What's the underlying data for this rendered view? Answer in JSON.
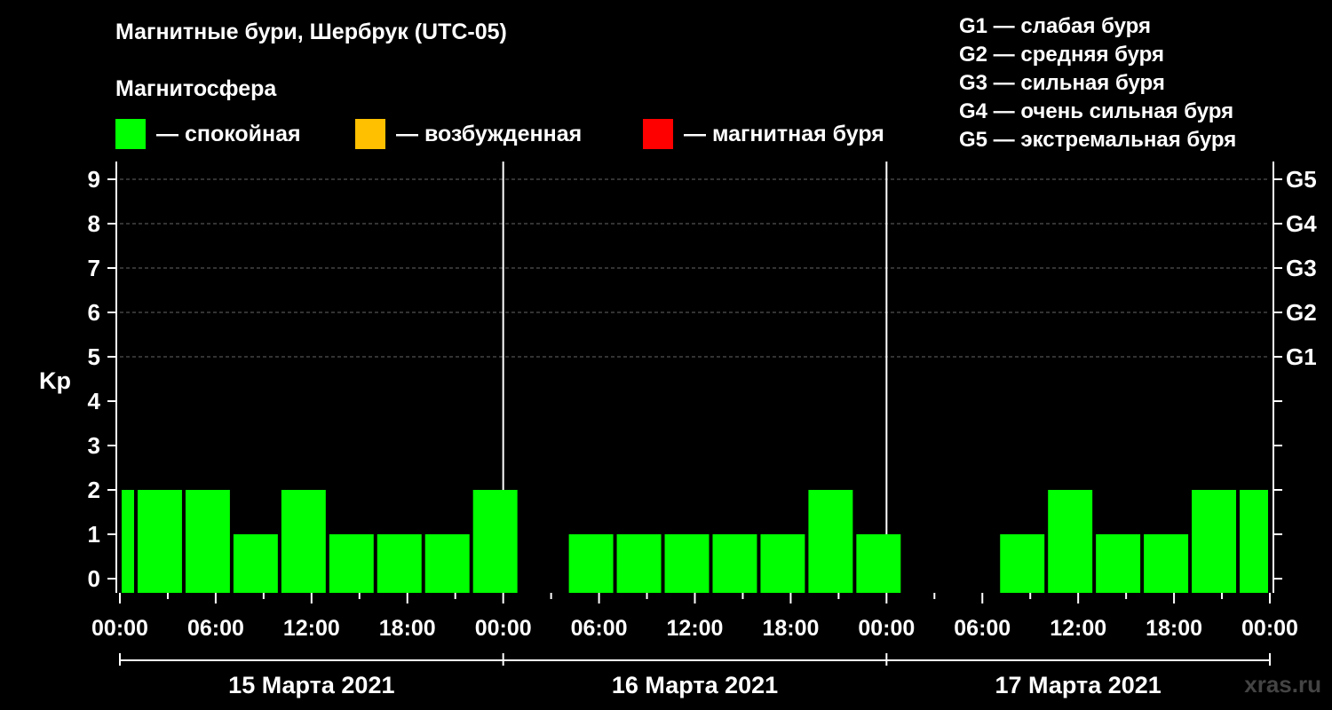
{
  "header": {
    "title": "Магнитные бури, Шербрук (UTC-05)",
    "subtitle": "Магнитосфера"
  },
  "legend": [
    {
      "label": "— спокойная",
      "color": "#00ff00"
    },
    {
      "label": "— возбужденная",
      "color": "#ffc000"
    },
    {
      "label": "— магнитная буря",
      "color": "#ff0000"
    }
  ],
  "storm_levels": [
    "G1 — слабая буря",
    "G2 — средняя буря",
    "G3 — сильная буря",
    "G4 — очень сильная буря",
    "G5 — экстремальная буря"
  ],
  "watermark": "xras.ru",
  "chart_data": {
    "type": "bar",
    "ylabel": "Kp",
    "ylim": [
      0,
      9
    ],
    "yticks": [
      "0",
      "1",
      "2",
      "3",
      "4",
      "5",
      "6",
      "7",
      "8",
      "9"
    ],
    "right_ticks": [
      {
        "kp": 5,
        "label": "G1"
      },
      {
        "kp": 6,
        "label": "G2"
      },
      {
        "kp": 7,
        "label": "G3"
      },
      {
        "kp": 8,
        "label": "G4"
      },
      {
        "kp": 9,
        "label": "G5"
      }
    ],
    "xticks": [
      "00:00",
      "06:00",
      "12:00",
      "18:00",
      "00:00",
      "06:00",
      "12:00",
      "18:00",
      "00:00",
      "06:00",
      "12:00",
      "18:00",
      "00:00"
    ],
    "days": [
      "15 Марта 2021",
      "16 Марта 2021",
      "17 Марта 2021"
    ],
    "grid": "dashed horizontal at Kp 5-9",
    "bars": [
      {
        "start_h": 0,
        "end_h": 1,
        "kp": 2
      },
      {
        "start_h": 1,
        "end_h": 4,
        "kp": 2
      },
      {
        "start_h": 4,
        "end_h": 7,
        "kp": 2
      },
      {
        "start_h": 7,
        "end_h": 10,
        "kp": 1
      },
      {
        "start_h": 10,
        "end_h": 13,
        "kp": 2
      },
      {
        "start_h": 13,
        "end_h": 16,
        "kp": 1
      },
      {
        "start_h": 16,
        "end_h": 19,
        "kp": 1
      },
      {
        "start_h": 19,
        "end_h": 22,
        "kp": 1
      },
      {
        "start_h": 22,
        "end_h": 25,
        "kp": 2
      },
      {
        "start_h": 25,
        "end_h": 28,
        "kp": 0
      },
      {
        "start_h": 28,
        "end_h": 31,
        "kp": 1
      },
      {
        "start_h": 31,
        "end_h": 34,
        "kp": 1
      },
      {
        "start_h": 34,
        "end_h": 37,
        "kp": 1
      },
      {
        "start_h": 37,
        "end_h": 40,
        "kp": 1
      },
      {
        "start_h": 40,
        "end_h": 43,
        "kp": 1
      },
      {
        "start_h": 43,
        "end_h": 46,
        "kp": 2
      },
      {
        "start_h": 46,
        "end_h": 49,
        "kp": 1
      },
      {
        "start_h": 49,
        "end_h": 52,
        "kp": 0
      },
      {
        "start_h": 52,
        "end_h": 55,
        "kp": 0
      },
      {
        "start_h": 55,
        "end_h": 58,
        "kp": 1
      },
      {
        "start_h": 58,
        "end_h": 61,
        "kp": 2
      },
      {
        "start_h": 61,
        "end_h": 64,
        "kp": 1
      },
      {
        "start_h": 64,
        "end_h": 67,
        "kp": 1
      },
      {
        "start_h": 67,
        "end_h": 70,
        "kp": 2
      },
      {
        "start_h": 70,
        "end_h": 72,
        "kp": 2
      }
    ]
  }
}
